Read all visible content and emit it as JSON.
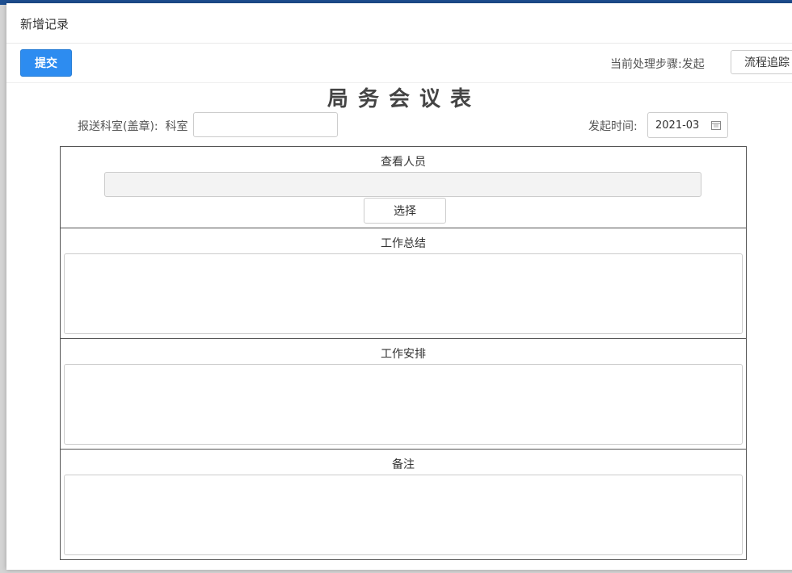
{
  "dialog": {
    "title": "新增记录"
  },
  "toolbar": {
    "submit_label": "提交",
    "step_label": "当前处理步骤:",
    "step_value": "发起",
    "trace_label": "流程追踪"
  },
  "form": {
    "title": "局务会议表",
    "dept_label": "报送科室(盖章):",
    "dept_prefix": "科室",
    "dept_value": "",
    "time_label": "发起时间:",
    "time_value": "2021-03",
    "sections": {
      "viewers": {
        "label": "查看人员",
        "select_label": "选择"
      },
      "summary": {
        "label": "工作总结"
      },
      "arrangement": {
        "label": "工作安排"
      },
      "remarks": {
        "label": "备注"
      }
    }
  },
  "icons": {
    "date_picker": "calendar-icon"
  },
  "colors": {
    "primary": "#2d8cf0",
    "topbar": "#1e4f91"
  }
}
